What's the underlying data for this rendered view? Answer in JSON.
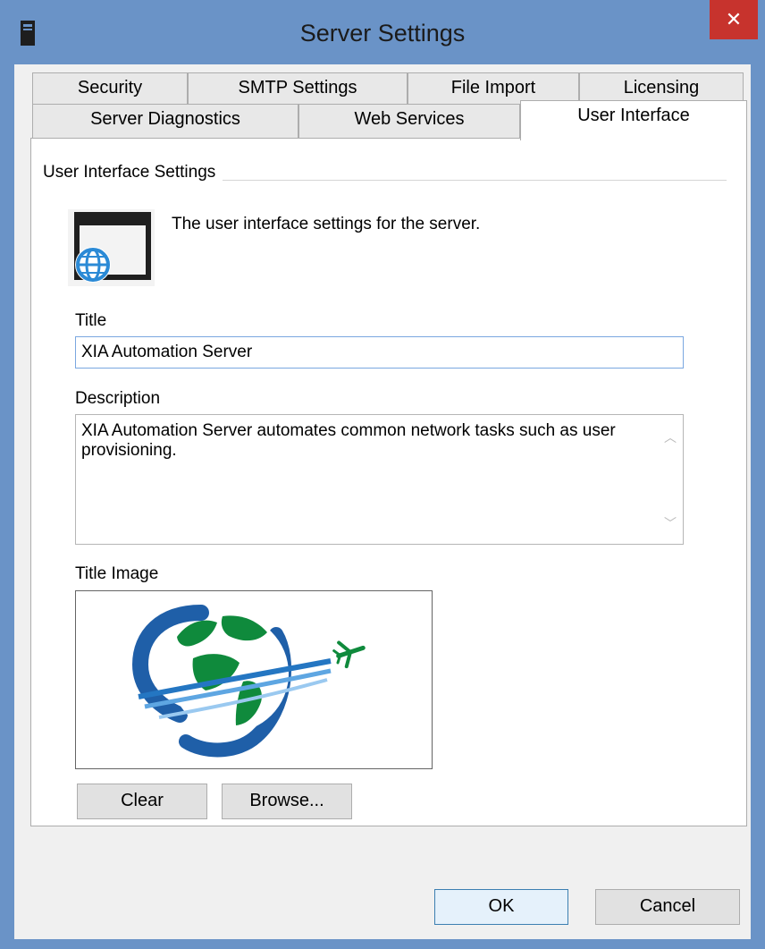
{
  "window": {
    "title": "Server Settings",
    "close_glyph": "✕"
  },
  "tabs": {
    "row1": [
      "Security",
      "SMTP Settings",
      "File Import",
      "Licensing"
    ],
    "row2": [
      "Server Diagnostics",
      "Web Services",
      "User Interface"
    ],
    "active": "User Interface"
  },
  "panel": {
    "group_title": "User Interface Settings",
    "description": "The user interface settings for the server.",
    "title_label": "Title",
    "title_value": "XIA Automation Server",
    "description_label": "Description",
    "description_value": "XIA Automation Server automates common network tasks such as user provisioning.",
    "title_image_label": "Title Image",
    "clear_button": "Clear",
    "browse_button": "Browse..."
  },
  "footer": {
    "ok_button": "OK",
    "cancel_button": "Cancel"
  },
  "colors": {
    "titlebar": "#6a93c7",
    "close": "#c7332d",
    "logo_blue": "#1f5fa8",
    "logo_green": "#0f8a3c",
    "globe_icon": "#2b8ad6"
  }
}
